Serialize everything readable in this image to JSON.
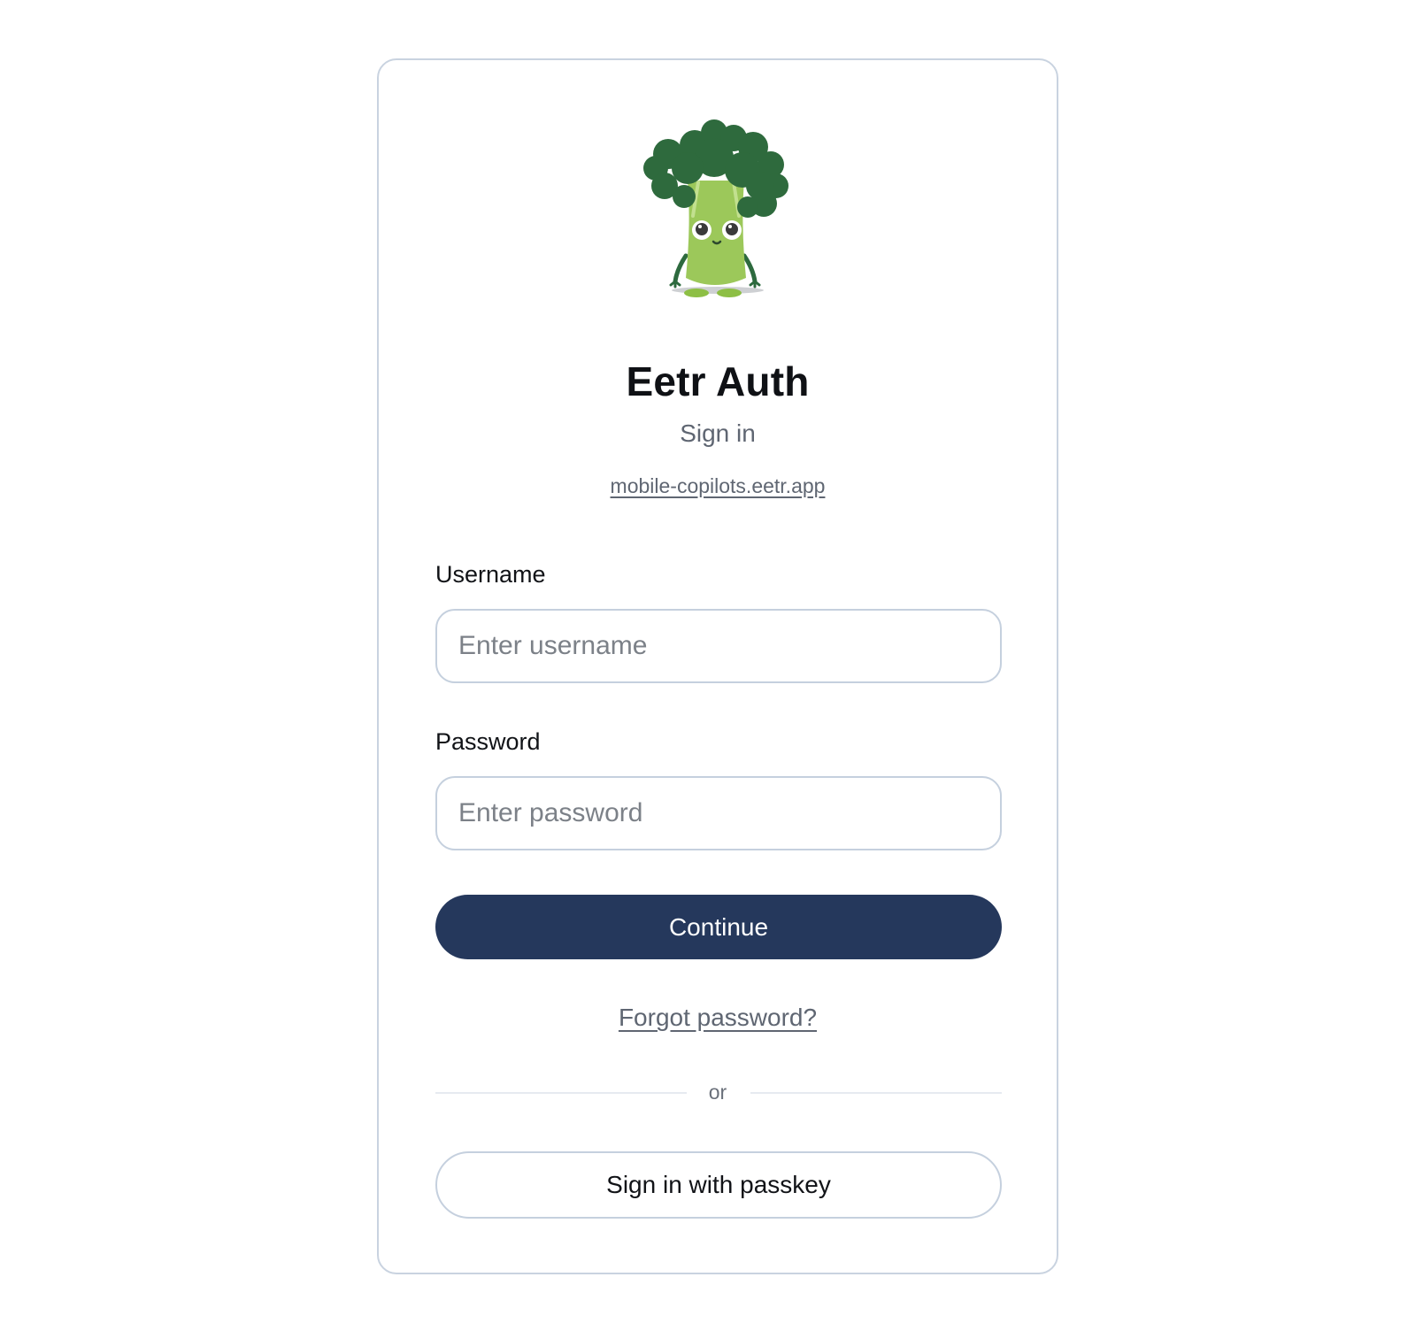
{
  "app": {
    "title": "Eetr Auth",
    "subtitle": "Sign in",
    "domain_link": "mobile-copilots.eetr.app"
  },
  "logo": {
    "icon": "broccoli-mascot-icon"
  },
  "form": {
    "username_label": "Username",
    "username_placeholder": "Enter username",
    "username_value": "",
    "password_label": "Password",
    "password_placeholder": "Enter password",
    "password_value": "",
    "continue_label": "Continue",
    "forgot_label": "Forgot password?",
    "divider_text": "or",
    "passkey_label": "Sign in with passkey"
  },
  "colors": {
    "primary_button": "#25385c",
    "card_border": "#c9d3e0",
    "muted_text": "#5f6672"
  }
}
